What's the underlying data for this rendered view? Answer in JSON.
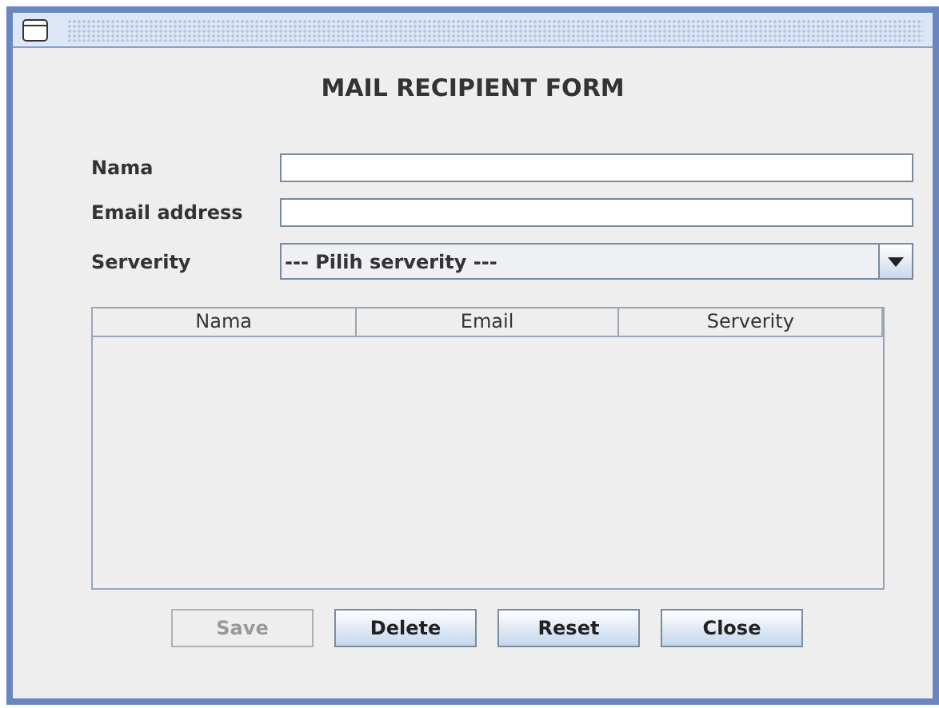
{
  "window": {
    "title": "MAIL RECIPIENT FORM"
  },
  "fields": [
    {
      "kind": "text",
      "label": "Nama"
    },
    {
      "kind": "text",
      "label": "Email address"
    },
    {
      "kind": "select",
      "label": "Serverity",
      "value": "--- Pilih serverity ---"
    }
  ],
  "table": {
    "columns": [
      "Nama",
      "Email",
      "Serverity"
    ]
  },
  "buttons": [
    {
      "label": "Save",
      "disabled": true
    },
    {
      "label": "Delete",
      "disabled": false
    },
    {
      "label": "Reset",
      "disabled": false
    },
    {
      "label": "Close",
      "disabled": false
    }
  ]
}
